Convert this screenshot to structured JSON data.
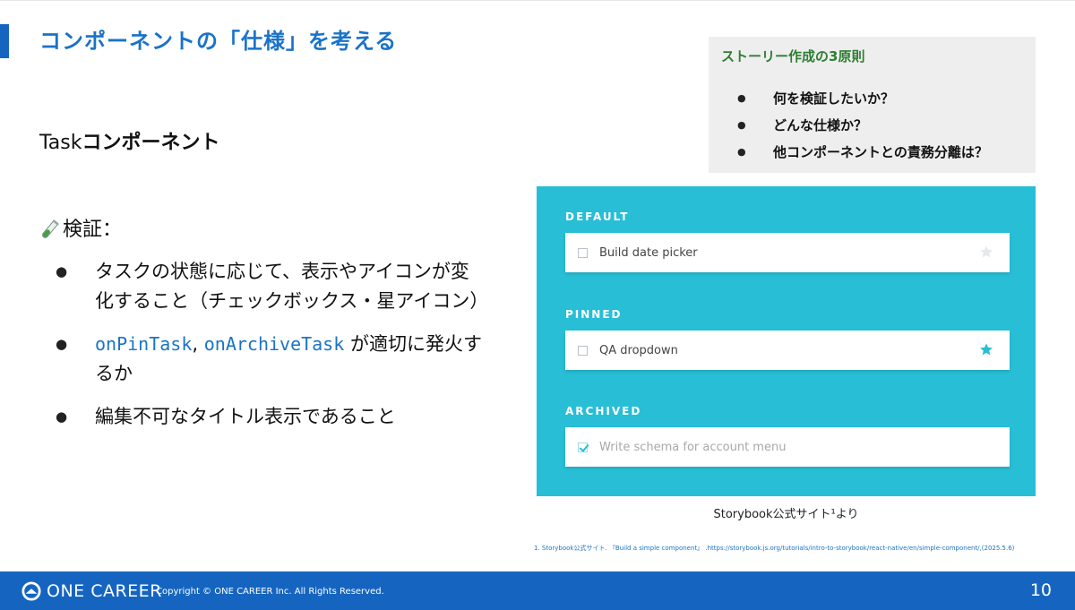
{
  "slide": {
    "title": "コンポーネントの「仕様」を考える",
    "subtitle_latin": "Task",
    "subtitle_jp": "コンポーネント",
    "verify_heading": "検証：",
    "bullets": [
      {
        "text": "タスクの状態に応じて、表示やアイコンが変化すること（チェックボックス・星アイコン）"
      },
      {
        "code1": "onPinTask",
        "sep": ", ",
        "code2": "onArchiveTask",
        "text": " が適切に発火するか"
      },
      {
        "text": "編集不可なタイトル表示であること"
      }
    ]
  },
  "principles": {
    "title": "ストーリー作成の3原則",
    "items": [
      "何を検証したいか？",
      "どんな仕様か？",
      "他コンポーネントとの責務分離は？"
    ]
  },
  "demo": {
    "bg_color": "#27bed6",
    "states": [
      {
        "label": "DEFAULT",
        "task": "Build date picker",
        "checked": false,
        "star": "empty-star-icon"
      },
      {
        "label": "PINNED",
        "task": "QA dropdown",
        "checked": false,
        "star": "filled-star-icon"
      },
      {
        "label": "ARCHIVED",
        "task": "Write schema for account menu",
        "checked": true,
        "star": ""
      }
    ]
  },
  "caption": "Storybook公式サイト¹より",
  "footnote": "1. Storybook公式サイト. 『Build a simple component』 .https://storybook.js.org/tutorials/intro-to-storybook/react-native/en/simple-component/,(2025.5.6)",
  "footer": {
    "logo_text": "ONE CAREER",
    "copyright": "Copyright © ONE CAREER Inc. All Rights Reserved.",
    "page_number": "10",
    "brand_color": "#1565c0"
  }
}
